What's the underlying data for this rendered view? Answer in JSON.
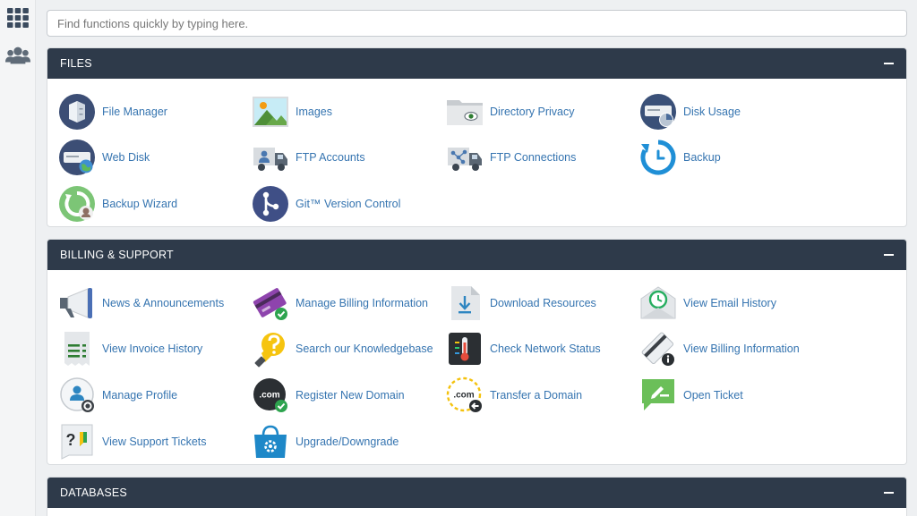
{
  "sidebar": {
    "apps_icon": "grid-icon",
    "users_icon": "users-icon"
  },
  "search": {
    "placeholder": "Find functions quickly by typing here."
  },
  "panels": [
    {
      "title": "FILES",
      "items": [
        {
          "label": "File Manager",
          "icon": "file-manager-icon"
        },
        {
          "label": "Images",
          "icon": "images-icon"
        },
        {
          "label": "Directory Privacy",
          "icon": "directory-privacy-icon"
        },
        {
          "label": "Disk Usage",
          "icon": "disk-usage-icon"
        },
        {
          "label": "Web Disk",
          "icon": "web-disk-icon"
        },
        {
          "label": "FTP Accounts",
          "icon": "ftp-accounts-icon"
        },
        {
          "label": "FTP Connections",
          "icon": "ftp-connections-icon"
        },
        {
          "label": "Backup",
          "icon": "backup-icon"
        },
        {
          "label": "Backup Wizard",
          "icon": "backup-wizard-icon"
        },
        {
          "label": "Git™ Version Control",
          "icon": "git-icon"
        }
      ]
    },
    {
      "title": "BILLING & SUPPORT",
      "items": [
        {
          "label": "News & Announcements",
          "icon": "megaphone-icon"
        },
        {
          "label": "Manage Billing Information",
          "icon": "credit-card-icon"
        },
        {
          "label": "Download Resources",
          "icon": "download-icon"
        },
        {
          "label": "View Email History",
          "icon": "email-history-icon"
        },
        {
          "label": "View Invoice History",
          "icon": "invoice-icon"
        },
        {
          "label": "Search our Knowledgebase",
          "icon": "lightbulb-icon"
        },
        {
          "label": "Check Network Status",
          "icon": "thermometer-icon"
        },
        {
          "label": "View Billing Information",
          "icon": "billing-info-icon"
        },
        {
          "label": "Manage Profile",
          "icon": "profile-icon"
        },
        {
          "label": "Register New Domain",
          "icon": "register-domain-icon"
        },
        {
          "label": "Transfer a Domain",
          "icon": "transfer-domain-icon"
        },
        {
          "label": "Open Ticket",
          "icon": "open-ticket-icon"
        },
        {
          "label": "View Support Tickets",
          "icon": "support-tickets-icon"
        },
        {
          "label": "Upgrade/Downgrade",
          "icon": "shopping-bag-icon"
        }
      ]
    },
    {
      "title": "DATABASES",
      "items": []
    }
  ],
  "colors": {
    "header": "#2e3a4a",
    "link": "#3574b0",
    "background": "#eef0f2"
  }
}
